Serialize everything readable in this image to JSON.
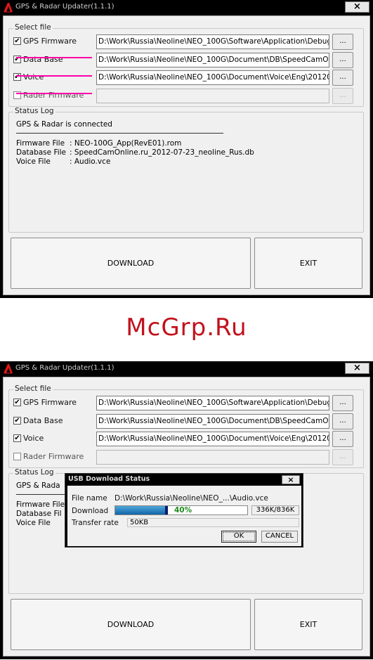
{
  "window_title": "GPS & Radar Updater(1.1.1)",
  "close_glyph": "×",
  "select_file_label": "Select file",
  "status_log_label": "Status Log",
  "firmware_rows": [
    {
      "label": "GPS Firmware",
      "checked": true,
      "path": "D:\\Work\\Russia\\Neoline\\NEO_100G\\Software\\Application\\Debug"
    },
    {
      "label": "Data Base",
      "checked": true,
      "path": "D:\\Work\\Russia\\Neoline\\NEO_100G\\Document\\DB\\SpeedCamO"
    },
    {
      "label": "Voice",
      "checked": true,
      "path": "D:\\Work\\Russia\\Neoline\\NEO_100G\\Document\\Voice\\Eng\\20120"
    },
    {
      "label": "Rader Firmware",
      "checked": false,
      "path": ""
    }
  ],
  "browse_label": "...",
  "check_glyph": "✔",
  "status_log": {
    "connected": "GPS & Radar is connected",
    "firmware_file_label": "Firmware File",
    "firmware_file_value": ": NEO-100G_App(RevE01).rom",
    "database_file_label": "Database File",
    "database_file_value": ": SpeedCamOnline.ru_2012-07-23_neoline_Rus.db",
    "voice_file_label": "Voice File",
    "voice_file_value": ": Audio.vce",
    "partial_connected": "GPS & Rada",
    "partial_firmware": "Firmware File",
    "partial_database": "Database Fil",
    "partial_voice": "Voice File"
  },
  "download_label": "DOWNLOAD",
  "exit_label": "EXIT",
  "watermark": "McGrp.Ru",
  "usb_dialog": {
    "title": "USB Download Status",
    "close_glyph": "×",
    "file_name_label": "File name",
    "file_name_value": "D:\\Work\\Russia\\Neoline\\NEO_...\\Audio.vce",
    "download_label": "Download",
    "progress_percent": 40,
    "progress_text": "40%",
    "size_text": "336K/836K",
    "transfer_rate_label": "Transfer rate",
    "transfer_rate_value": "50KB",
    "ok_label": "OK",
    "cancel_label": "CANCEL"
  },
  "colors": {
    "titlebar": "#000000",
    "client": "#f0f0f0",
    "underline": "#ff00aa",
    "watermark": "#c1121c",
    "progress": "#1464a8",
    "progress_text": "#1c8a1c"
  }
}
